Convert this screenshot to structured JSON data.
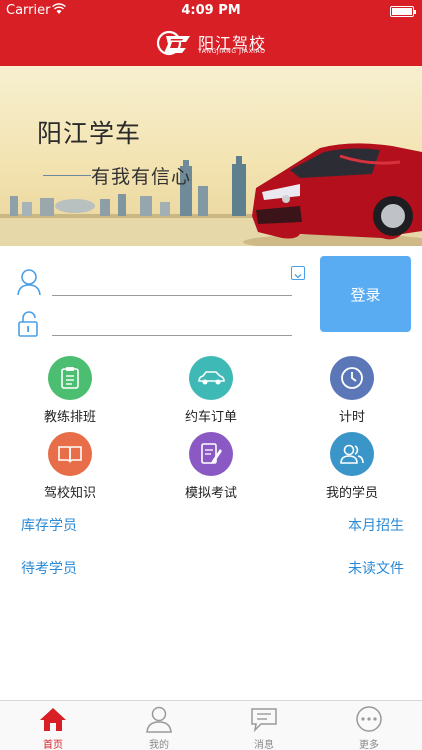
{
  "status_bar": {
    "carrier": "Carrier",
    "time": "4:09 PM"
  },
  "nav": {
    "logo_title": "阳江驾校",
    "logo_subtitle": "YANGJIANG JIAXIAO"
  },
  "banner": {
    "headline": "阳江学车",
    "slogan": "有我有信心"
  },
  "login": {
    "username_value": "",
    "password_value": "",
    "button_label": "登录"
  },
  "grid": [
    {
      "label": "教练排班",
      "icon": "clipboard-icon",
      "color": "#4cbe71"
    },
    {
      "label": "约车订单",
      "icon": "car-icon",
      "color": "#3fb9b6"
    },
    {
      "label": "计时",
      "icon": "clock-icon",
      "color": "#5c77b8"
    },
    {
      "label": "驾校知识",
      "icon": "book-icon",
      "color": "#e76e48"
    },
    {
      "label": "模拟考试",
      "icon": "exam-icon",
      "color": "#8b59c4"
    },
    {
      "label": "我的学员",
      "icon": "students-icon",
      "color": "#3a95c9"
    }
  ],
  "links": {
    "stock_students": "库存学员",
    "monthly_enrollment": "本月招生",
    "pending_exam_students": "待考学员",
    "unread_files": "未读文件"
  },
  "tabbar": [
    {
      "label": "首页",
      "icon": "home-icon",
      "active": true
    },
    {
      "label": "我的",
      "icon": "person-icon",
      "active": false
    },
    {
      "label": "消息",
      "icon": "message-icon",
      "active": false
    },
    {
      "label": "更多",
      "icon": "more-icon",
      "active": false
    }
  ],
  "colors": {
    "brand_red": "#d81f26",
    "button_blue": "#5aacf2",
    "link_blue": "#2a8ad6"
  }
}
